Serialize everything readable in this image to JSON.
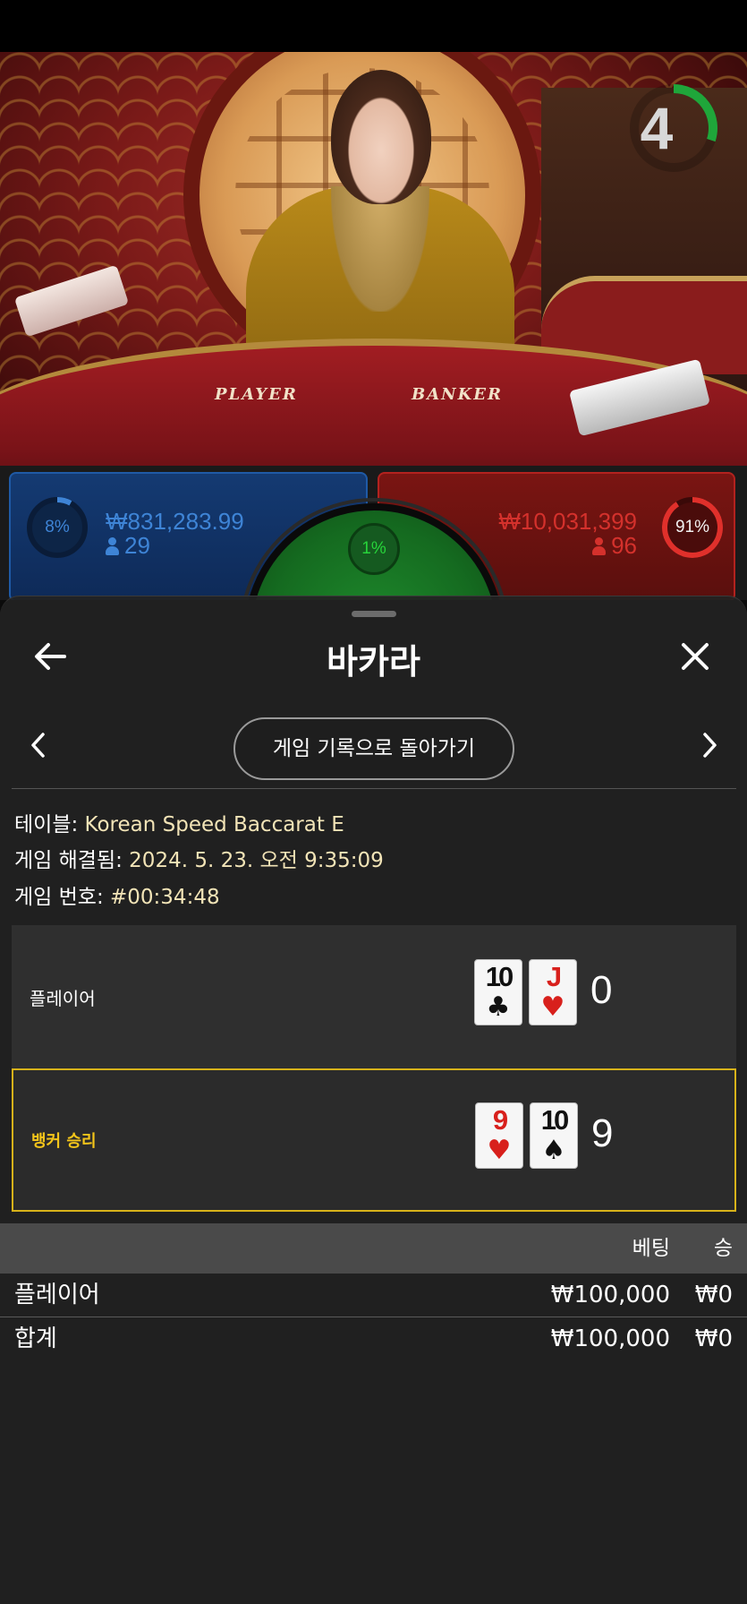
{
  "video": {
    "countdown": "4",
    "countdown_progress": 0.3,
    "table_labels": {
      "player": "PLAYER",
      "banker": "BANKER"
    }
  },
  "bets": {
    "player": {
      "percent": "8%",
      "percent_value": 0.08,
      "amount": "₩831,283.99",
      "count": "29",
      "color": "#3e84d6"
    },
    "tie": {
      "percent": "1%",
      "percent_value": 0.01,
      "color": "#27d43a"
    },
    "banker": {
      "percent": "91%",
      "percent_value": 0.91,
      "amount": "₩10,031,399",
      "count": "96",
      "color": "#d4312c"
    }
  },
  "modal": {
    "title": "바카라",
    "back_icon": "arrow-left-icon",
    "close_icon": "close-icon",
    "prev_icon": "chevron-left-icon",
    "next_icon": "chevron-right-icon",
    "history_button": "게임 기록으로 돌아가기",
    "info": {
      "table_label": "테이블: ",
      "table_value": "Korean Speed Baccarat E",
      "resolved_label": "게임 해결됨: ",
      "resolved_value": "2024. 5. 23. 오전 9:35:09",
      "game_no_label": "게임 번호: ",
      "game_no_value": "#00:34:48"
    },
    "results": [
      {
        "label": "플레이어",
        "winner": false,
        "cards": [
          {
            "rank": "10",
            "suit": "♣",
            "color": "black"
          },
          {
            "rank": "J",
            "suit": "♥",
            "color": "red"
          }
        ],
        "score": "0"
      },
      {
        "label": "뱅커 승리",
        "winner": true,
        "cards": [
          {
            "rank": "9",
            "suit": "♥",
            "color": "red"
          },
          {
            "rank": "10",
            "suit": "♠",
            "color": "black"
          }
        ],
        "score": "9"
      }
    ],
    "bets_table": {
      "headers": {
        "bet": "베팅",
        "win": "승"
      },
      "rows": [
        {
          "name": "플레이어",
          "bet": "₩100,000",
          "win": "₩0"
        },
        {
          "name": "합계",
          "bet": "₩100,000",
          "win": "₩0"
        }
      ]
    },
    "accent_color": "#d7b21a"
  }
}
